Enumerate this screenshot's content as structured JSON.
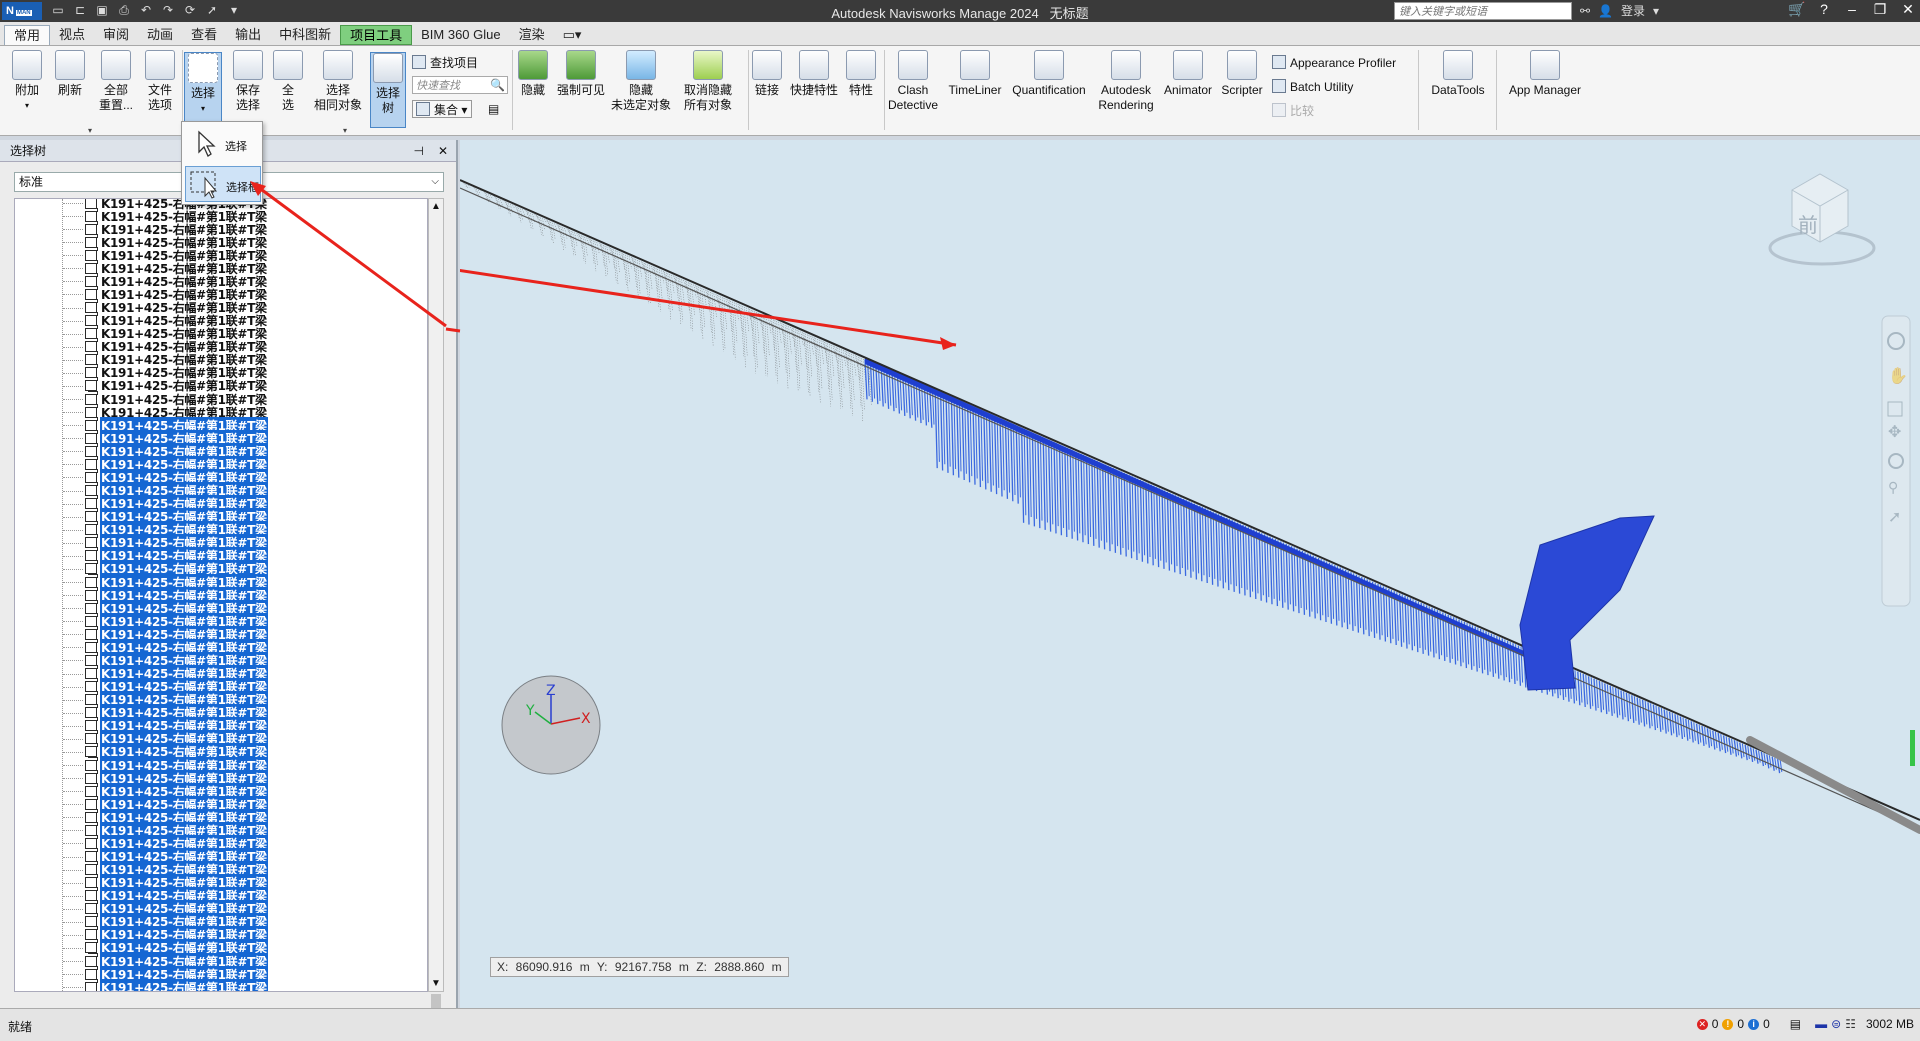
{
  "app": {
    "logo": "N",
    "logo_sub": "MAN",
    "title": "Autodesk Navisworks Manage 2024",
    "doc": "无标题",
    "search_placeholder": "键入关键字或短语",
    "login": "登录"
  },
  "tabs": [
    "常用",
    "视点",
    "审阅",
    "动画",
    "查看",
    "输出",
    "中科图新",
    "项目工具",
    "BIM 360 Glue",
    "渲染"
  ],
  "ribbon": {
    "append": "附加",
    "refresh": "刷新",
    "reset_all_1": "全部",
    "reset_all_2": "重置...",
    "file_options_1": "文件",
    "file_options_2": "选项",
    "select": "选择",
    "save_selection_1": "保存",
    "save_selection_2": "选择",
    "select_all_1": "全",
    "select_all_2": "选",
    "select_same_1": "选择",
    "select_same_2": "相同对象",
    "selection_tree_1": "选择",
    "selection_tree_2": "树",
    "find_items": "查找项目",
    "quick_find_placeholder": "快速查找",
    "sets": "集合",
    "hide": "隐藏",
    "require": "强制可见",
    "hide_unselected_1": "隐藏",
    "hide_unselected_2": "未选定对象",
    "unhide_all_1": "取消隐藏",
    "unhide_all_2": "所有对象",
    "links": "链接",
    "quick_props": "快捷特性",
    "properties": "特性",
    "clash_1": "Clash",
    "clash_2": "Detective",
    "timeliner": "TimeLiner",
    "quantification": "Quantification",
    "rendering_1": "Autodesk",
    "rendering_2": "Rendering",
    "animator": "Animator",
    "scripter": "Scripter",
    "appearance_profiler": "Appearance Profiler",
    "batch_utility": "Batch Utility",
    "compare": "比较",
    "datatools": "DataTools",
    "app_manager": "App Manager"
  },
  "menu": {
    "item1": "选择",
    "item2": "选择框"
  },
  "panel": {
    "title": "选择树",
    "combo_value": "标准",
    "item_label": "K191+425-右幅#第1联#T梁",
    "rows": [
      false,
      false,
      false,
      false,
      false,
      false,
      false,
      false,
      false,
      false,
      false,
      false,
      false,
      false,
      false,
      false,
      false,
      true,
      true,
      true,
      true,
      true,
      true,
      true,
      true,
      true,
      true,
      true,
      true,
      true,
      true,
      true,
      true,
      true,
      true,
      true,
      true,
      true,
      true,
      true,
      true,
      true,
      true,
      true,
      true,
      true,
      true,
      true,
      true,
      true,
      true,
      true,
      true,
      true,
      true,
      true,
      true,
      true,
      true,
      true,
      true,
      true,
      true
    ]
  },
  "viewport": {
    "viewcube_label": "前",
    "axis_x": "X",
    "axis_y": "Y",
    "axis_z": "Z",
    "coords": "X: 86090.916 m  Y: 92167.758 m  Z: 2888.860 m"
  },
  "status": {
    "text": "就绪",
    "errors": "0",
    "warnings": "0",
    "infos": "0",
    "memory": "3002 MB"
  },
  "colors": {
    "selection_blue": "#1567d3",
    "model_blue": "#2b49d6",
    "annotation_red": "#e8231c"
  }
}
